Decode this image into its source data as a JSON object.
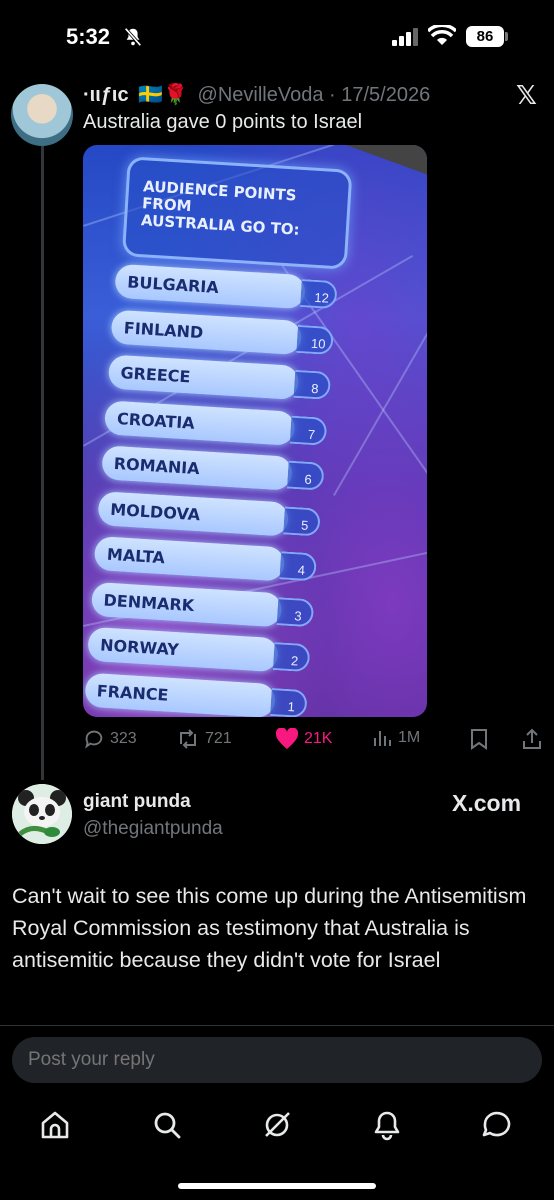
{
  "status_bar": {
    "time": "5:32",
    "battery": "86"
  },
  "tweet": {
    "display_name": "·ιιƒιc",
    "flags": "🇸🇪🌹",
    "handle": "@NevilleVoda",
    "date": "· 17/5/2026",
    "text": "Australia gave 0 points to Israel",
    "x_logo": "𝕏",
    "media": {
      "title_lines": [
        "AUDIENCE POINTS FROM",
        "AUSTRALIA GO TO:"
      ],
      "rows": [
        {
          "country": "BULGARIA",
          "points": "12"
        },
        {
          "country": "FINLAND",
          "points": "10"
        },
        {
          "country": "GREECE",
          "points": "8"
        },
        {
          "country": "CROATIA",
          "points": "7"
        },
        {
          "country": "ROMANIA",
          "points": "6"
        },
        {
          "country": "MOLDOVA",
          "points": "5"
        },
        {
          "country": "MALTA",
          "points": "4"
        },
        {
          "country": "DENMARK",
          "points": "3"
        },
        {
          "country": "NORWAY",
          "points": "2"
        },
        {
          "country": "FRANCE",
          "points": "1"
        }
      ]
    },
    "stats": {
      "replies": "323",
      "reposts": "721",
      "likes": "21K",
      "views": "1M"
    }
  },
  "reply": {
    "display_name": "giant punda",
    "handle": "@thegiantpunda",
    "source": "X.com",
    "text": "Can't wait to see this come up during the Antisemitism Royal Commission as testimony that Australia is antisemitic because they didn't vote for Israel"
  },
  "composer": {
    "placeholder": "Post your reply"
  },
  "colors": {
    "like": "#f91880",
    "muted": "#71767b",
    "text": "#e7e9ea"
  },
  "nav": [
    "home-icon",
    "search-icon",
    "grok-icon",
    "notifications-icon",
    "messages-icon"
  ]
}
